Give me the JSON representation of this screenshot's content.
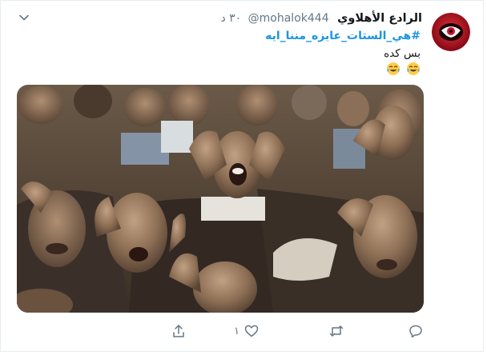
{
  "tweet": {
    "author_name": "الرادع الأهلاوي",
    "author_handle": "@mohalok444",
    "timestamp": "٣٠ د",
    "hashtag": "#هي_الستات_عايزه_مننا_ايه",
    "text": "بس كده",
    "emoji": [
      "face-with-tears-of-joy",
      "face-with-tears-of-joy"
    ],
    "like_count": "١"
  },
  "icons": {
    "more": "chevron-down-icon",
    "share": "share-icon",
    "like": "heart-icon",
    "retweet": "retweet-icon",
    "reply": "reply-icon"
  },
  "colors": {
    "link": "#1b95e0",
    "muted": "#657786",
    "avatar_red": "#c8102e"
  }
}
